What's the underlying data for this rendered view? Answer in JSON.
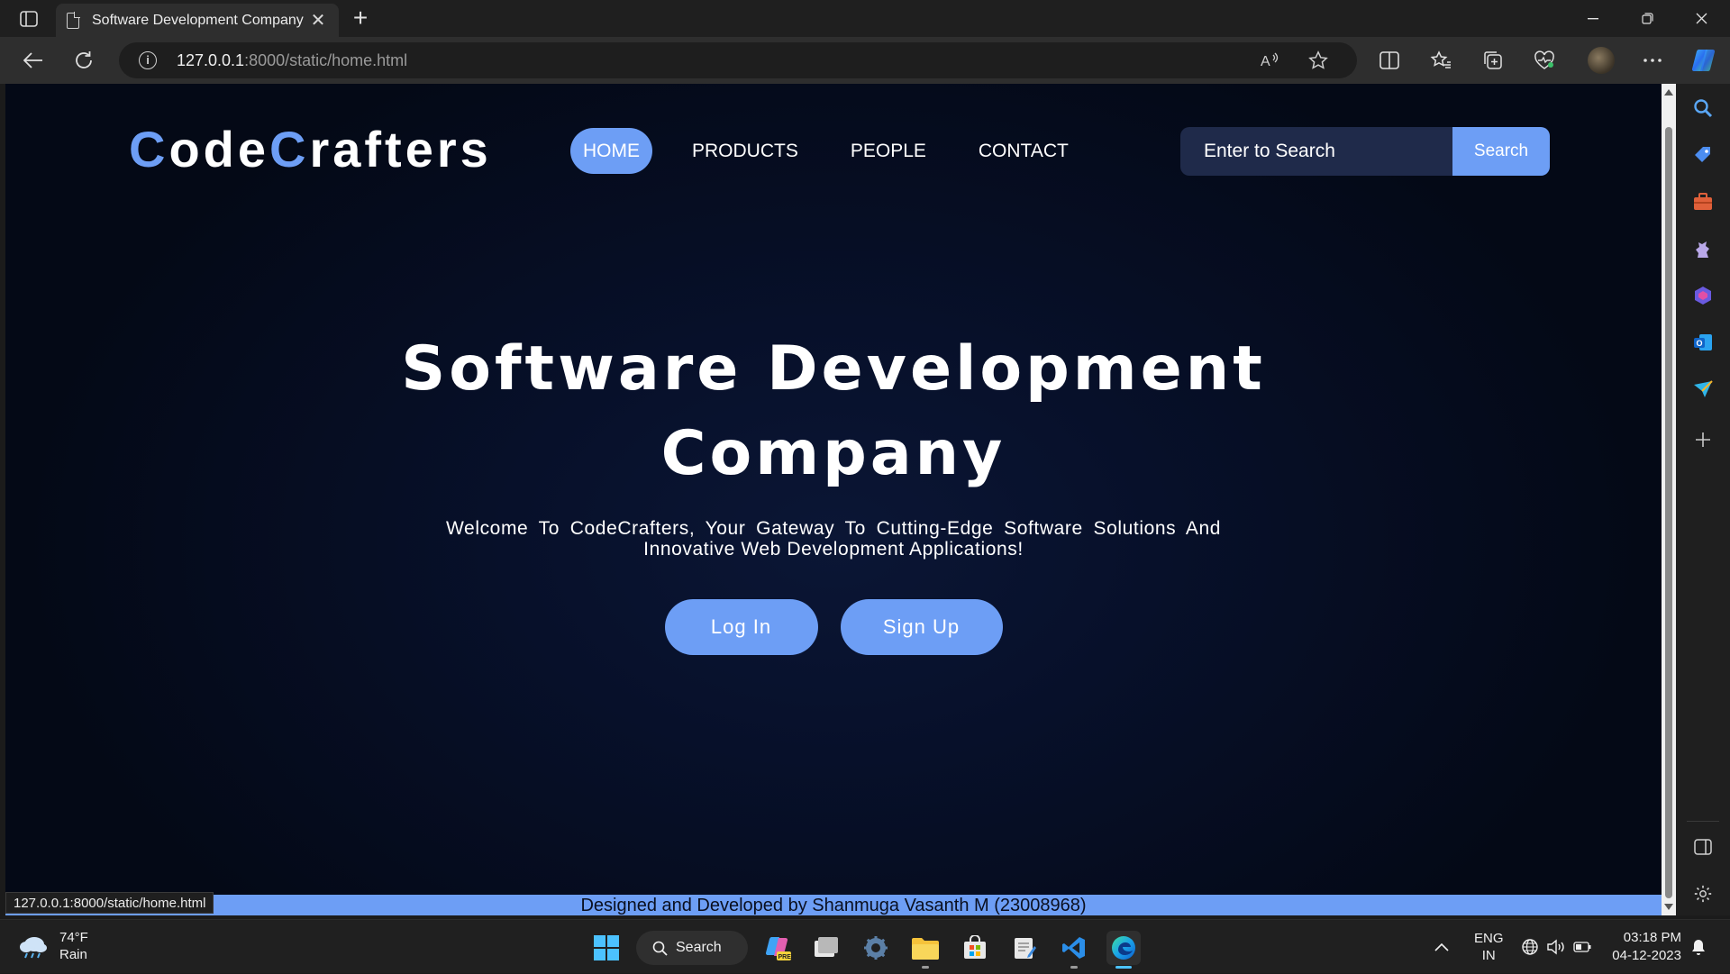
{
  "browser": {
    "tab_title": "Software Development Company",
    "url_host": "127.0.0.1",
    "url_rest": ":8000/static/home.html",
    "status_url": "127.0.0.1:8000/static/home.html"
  },
  "site": {
    "logo": {
      "c1": "C",
      "part1": "ode",
      "c2": "C",
      "part2": "rafters"
    },
    "nav": [
      {
        "label": "HOME",
        "active": true
      },
      {
        "label": "PRODUCTS",
        "active": false
      },
      {
        "label": "PEOPLE",
        "active": false
      },
      {
        "label": "CONTACT",
        "active": false
      }
    ],
    "search": {
      "placeholder": "Enter to Search",
      "button": "Search"
    },
    "hero": {
      "title": "Software Development Company",
      "subtitle": "Welcome To CodeCrafters, Your Gateway To Cutting-Edge Software Solutions And Innovative Web Development Applications!",
      "login": "Log In",
      "signup": "Sign Up"
    },
    "footer": "Designed and Developed by Shanmuga Vasanth M (23008968)",
    "colors": {
      "accent": "#6d9ef5",
      "background": "#040916"
    }
  },
  "taskbar": {
    "weather_temp": "74°F",
    "weather_desc": "Rain",
    "search_label": "Search",
    "lang_top": "ENG",
    "lang_bottom": "IN",
    "time": "03:18 PM",
    "date": "04-12-2023"
  }
}
